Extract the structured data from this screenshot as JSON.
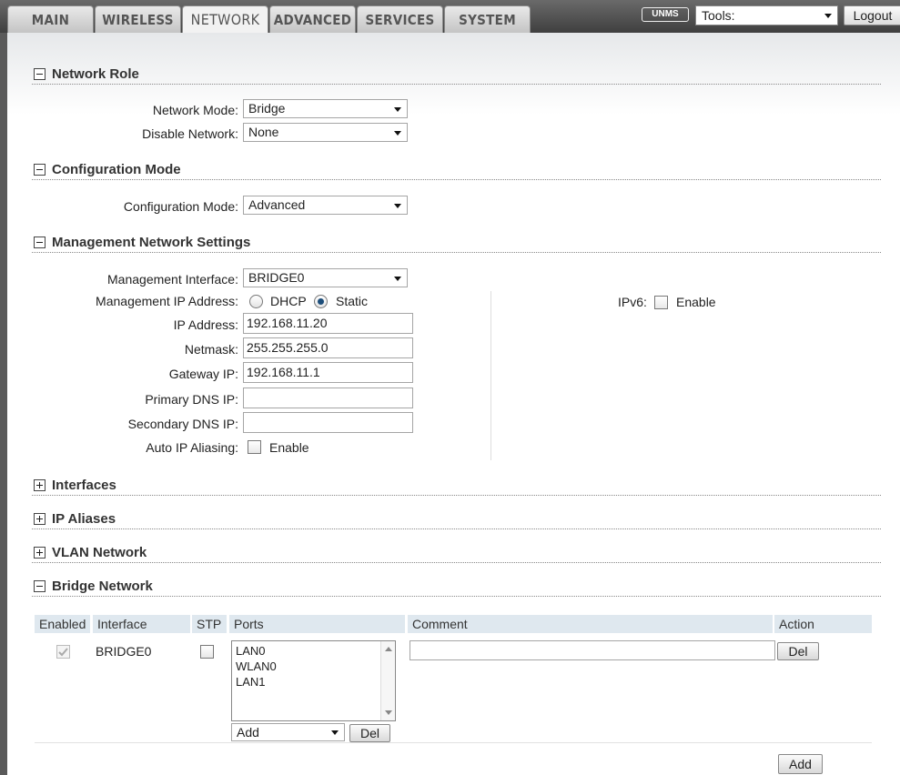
{
  "tabs": [
    "MAIN",
    "WIRELESS",
    "NETWORK",
    "ADVANCED",
    "SERVICES",
    "SYSTEM"
  ],
  "active_tab": "NETWORK",
  "header": {
    "unms_badge": "UNMS",
    "tools_value": "Tools:",
    "logout_label": "Logout"
  },
  "network_role": {
    "title": "Network Role",
    "network_mode_label": "Network Mode:",
    "network_mode_value": "Bridge",
    "disable_network_label": "Disable Network:",
    "disable_network_value": "None"
  },
  "configuration_mode": {
    "title": "Configuration Mode",
    "label": "Configuration Mode:",
    "value": "Advanced"
  },
  "management": {
    "title": "Management Network Settings",
    "interface_label": "Management Interface:",
    "interface_value": "BRIDGE0",
    "ip_mode_label": "Management IP Address:",
    "dhcp_label": "DHCP",
    "static_label": "Static",
    "ip_mode_selected": "Static",
    "ip_label": "IP Address:",
    "ip_value": "192.168.11.20",
    "netmask_label": "Netmask:",
    "netmask_value": "255.255.255.0",
    "gateway_label": "Gateway IP:",
    "gateway_value": "192.168.11.1",
    "primary_dns_label": "Primary DNS IP:",
    "primary_dns_value": "",
    "secondary_dns_label": "Secondary DNS IP:",
    "secondary_dns_value": "",
    "auto_alias_label": "Auto IP Aliasing:",
    "auto_alias_enable": "Enable",
    "ipv6_label": "IPv6:",
    "ipv6_enable": "Enable"
  },
  "collapsed_sections": [
    "Interfaces",
    "IP Aliases",
    "VLAN Network"
  ],
  "bridge": {
    "title": "Bridge Network",
    "columns": [
      "Enabled",
      "Interface",
      "STP",
      "Ports",
      "Comment",
      "Action"
    ],
    "row": {
      "enabled": true,
      "interface": "BRIDGE0",
      "stp": false,
      "ports": [
        "LAN0",
        "WLAN0",
        "LAN1"
      ],
      "comment": "",
      "del_label": "Del"
    },
    "port_add_value": "Add",
    "port_del_label": "Del",
    "add_label": "Add"
  },
  "colors": {
    "topbar": "#4a4a4a",
    "table_header": "#dfe8ef",
    "radio_selected": "#1d4e7a"
  }
}
